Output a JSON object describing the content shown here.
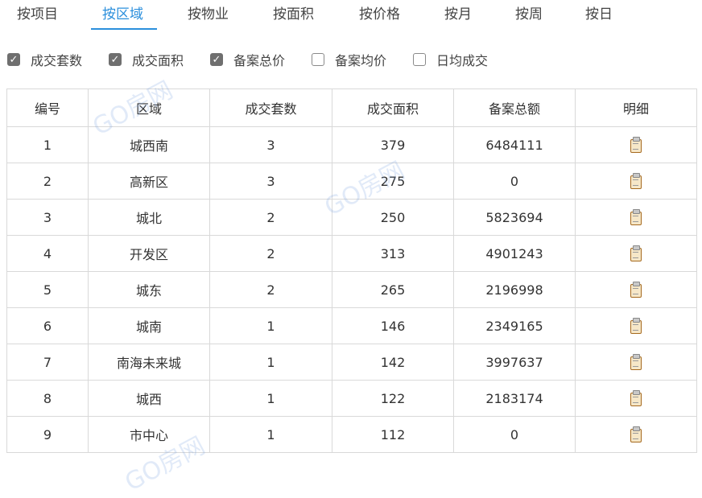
{
  "tabs": [
    "按项目",
    "按区域",
    "按物业",
    "按面积",
    "按价格",
    "按月",
    "按周",
    "按日"
  ],
  "active_tab": "按区域",
  "filters": [
    {
      "label": "成交套数",
      "checked": true
    },
    {
      "label": "成交面积",
      "checked": true
    },
    {
      "label": "备案总价",
      "checked": true
    },
    {
      "label": "备案均价",
      "checked": false
    },
    {
      "label": "日均成交",
      "checked": false
    }
  ],
  "table": {
    "headers": [
      "编号",
      "区域",
      "成交套数",
      "成交面积",
      "备案总额",
      "明细"
    ],
    "rows": [
      [
        "1",
        "城西南",
        "3",
        "379",
        "6484111"
      ],
      [
        "2",
        "高新区",
        "3",
        "275",
        "0"
      ],
      [
        "3",
        "城北",
        "2",
        "250",
        "5823694"
      ],
      [
        "4",
        "开发区",
        "2",
        "313",
        "4901243"
      ],
      [
        "5",
        "城东",
        "2",
        "265",
        "2196998"
      ],
      [
        "6",
        "城南",
        "1",
        "146",
        "2349165"
      ],
      [
        "7",
        "南海未来城",
        "1",
        "142",
        "3997637"
      ],
      [
        "8",
        "城西",
        "1",
        "122",
        "2183174"
      ],
      [
        "9",
        "市中心",
        "1",
        "112",
        "0"
      ]
    ],
    "detail_icon": "clipboard-icon"
  },
  "watermark": "GO房网",
  "colors": {
    "accent": "#2b8fdc",
    "checkbox_checked": "#6f6f6f",
    "border": "#d9d9d9"
  }
}
